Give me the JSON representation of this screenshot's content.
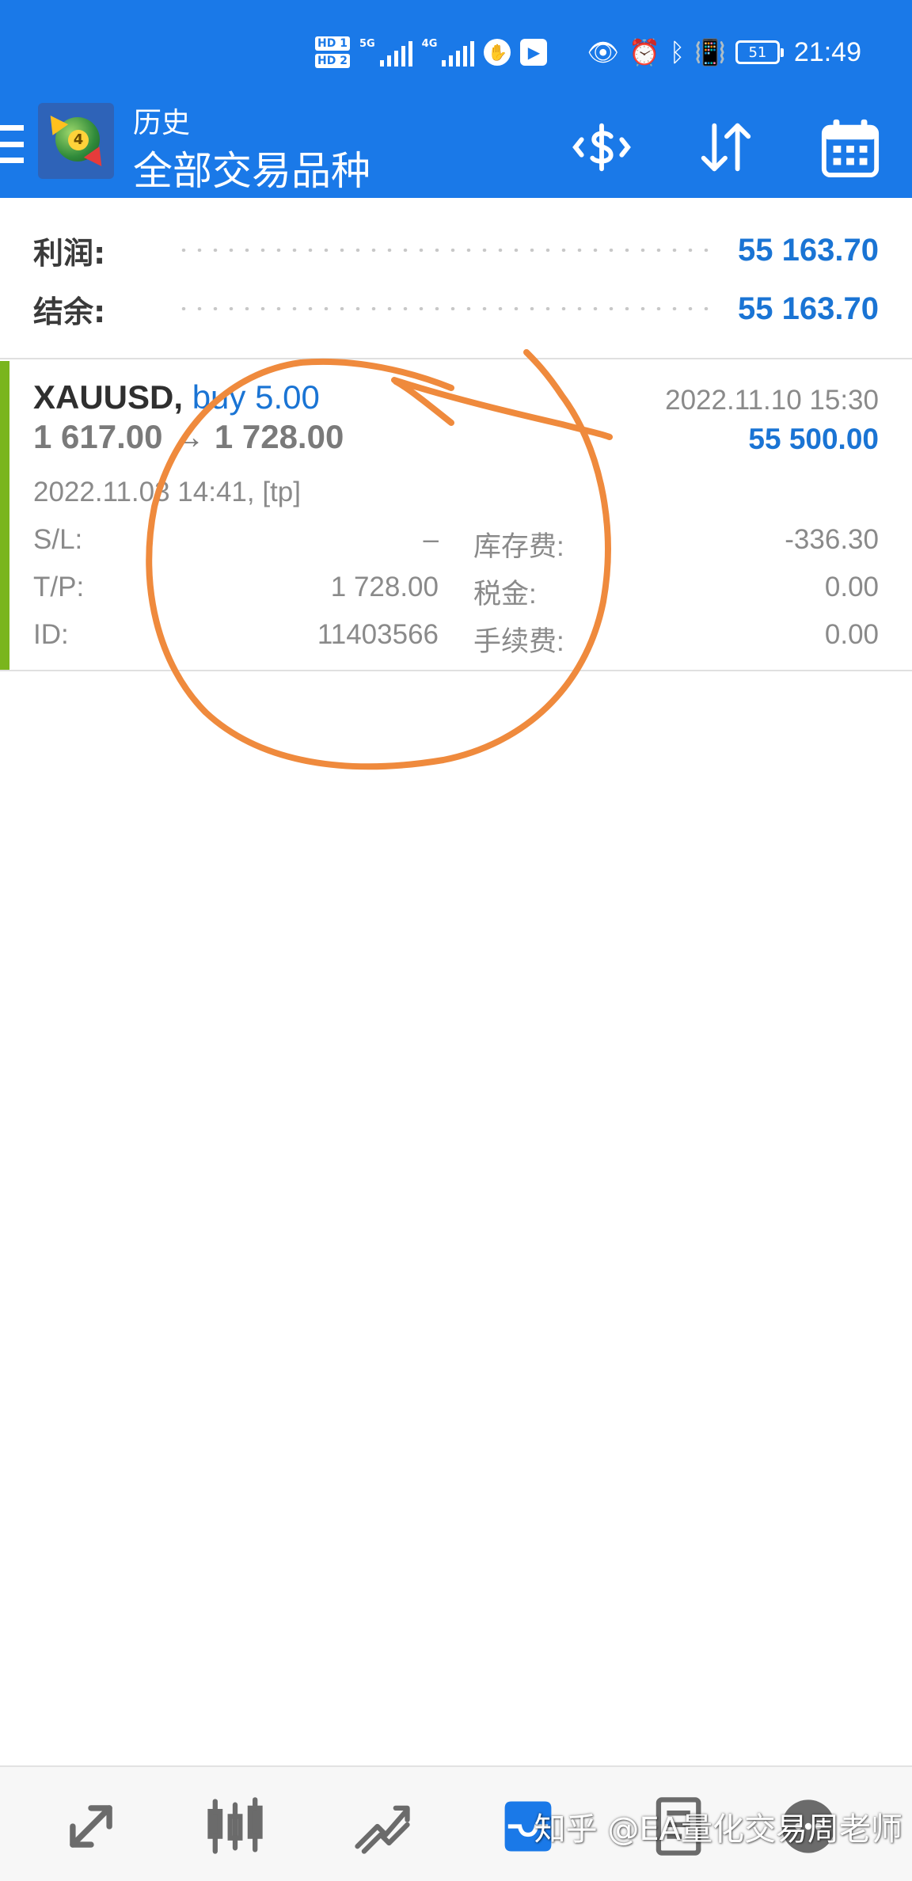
{
  "status_bar": {
    "sim1": "HD 1",
    "sim2": "HD 2",
    "net1": "5G",
    "net2": "4G",
    "battery": "51",
    "time": "21:49"
  },
  "app_bar": {
    "title": "历史",
    "subtitle": "全部交易品种",
    "accent_color": "#1a79e8"
  },
  "summary": {
    "profit_label": "利润:",
    "profit_value": "55 163.70",
    "balance_label": "结余:",
    "balance_value": "55 163.70"
  },
  "deal": {
    "symbol": "XAUUSD,",
    "side": "buy 5.00",
    "prices": "1 617.00 → 1 728.00",
    "close_time": "2022.11.10 15:30",
    "profit": "55 500.00",
    "open_time": "2022.11.03 14:41, [tp]",
    "sl_label": "S/L:",
    "sl_value": "–",
    "tp_label": "T/P:",
    "tp_value": "1 728.00",
    "id_label": "ID:",
    "id_value": "11403566",
    "swap_label": "库存费:",
    "swap_value": "-336.30",
    "tax_label": "税金:",
    "tax_value": "0.00",
    "fee_label": "手续费:",
    "fee_value": "0.00",
    "bar_color": "#7ab51d"
  },
  "bottom_nav": {
    "items": [
      "quotes-icon",
      "chart-icon",
      "trade-icon",
      "history-icon",
      "news-icon",
      "chat-icon"
    ],
    "active": "history-icon"
  },
  "watermark": "知乎 @EA量化交易周老师"
}
